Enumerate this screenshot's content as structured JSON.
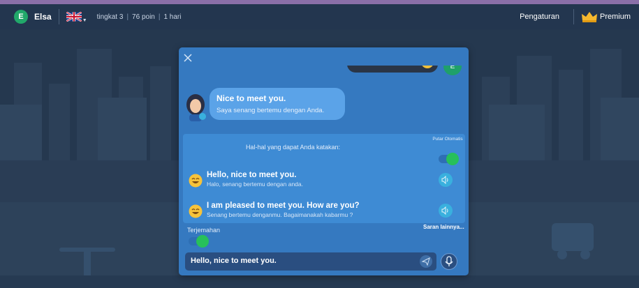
{
  "header": {
    "avatar_letter": "E",
    "user_name": "Elsa",
    "level": "tingkat 3",
    "points": "76 poin",
    "streak": "1 hari",
    "settings_label": "Pengaturan",
    "premium_label": "Premium",
    "flag_icon": "uk-flag-icon",
    "crown_icon": "crown-icon"
  },
  "dialog": {
    "bot_message": {
      "en": "Nice to meet you.",
      "id": "Saya senang bertemu dengan Anda."
    },
    "user_avatar_letter": "E",
    "suggestions_title": "Hal-hal yang dapat Anda katakan:",
    "autoplay_label": "Putar Otomatis",
    "phrases": [
      {
        "en": "Hello, nice to meet you.",
        "id": "Halo, senang bertemu dengan anda."
      },
      {
        "en": "I am pleased to meet you. How are you?",
        "id": "Senang bertemu denganmu. Bagaimanakah kabarmu ?"
      }
    ],
    "more_suggestions_label": "Saran lainnya...",
    "translation_label": "Terjemahan",
    "input_value": "Hello, nice to meet you."
  },
  "colors": {
    "dialog_bg": "#3579c0",
    "suggestion_panel": "#3e8bd4",
    "bot_bubble": "#5ba3e8",
    "toggle_on": "#27c05a",
    "avatar_green": "#21a86a"
  }
}
